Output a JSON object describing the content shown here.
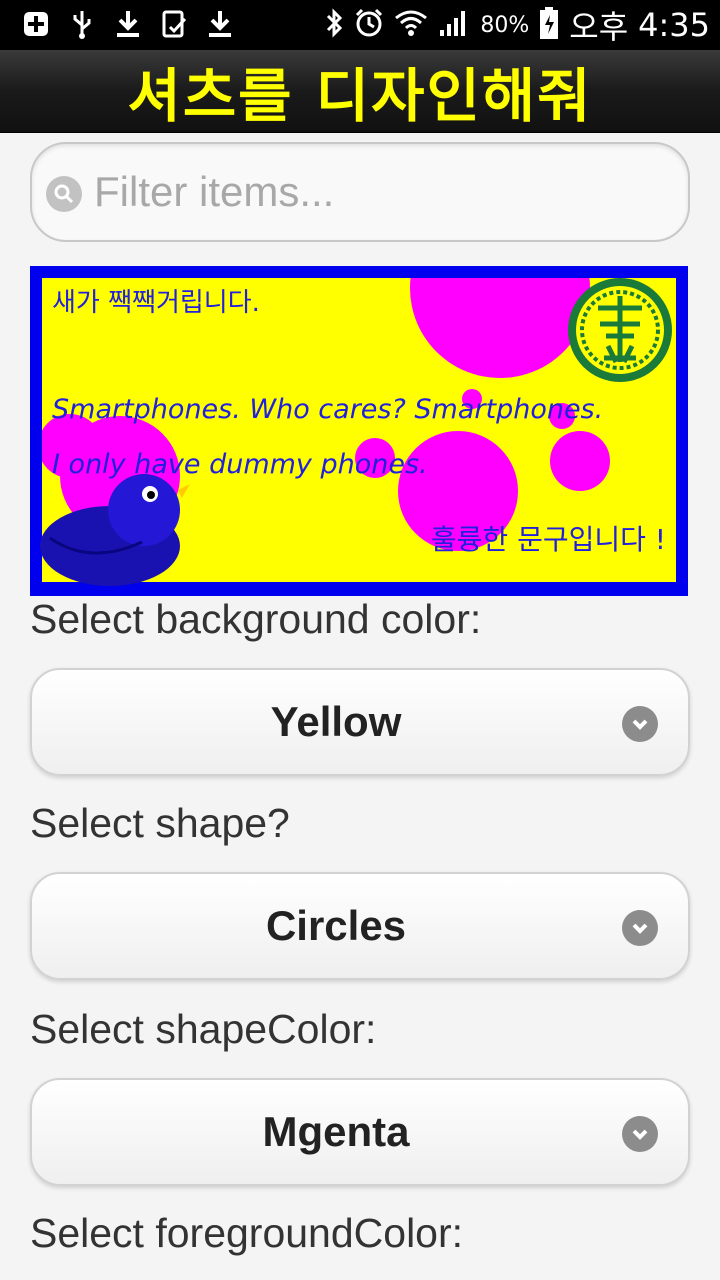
{
  "status_bar": {
    "left_icons": [
      "add-icon",
      "usb-icon",
      "download-icon",
      "screenshot-icon",
      "download-icon"
    ],
    "battery": "80%",
    "carrier_time_prefix": "오후",
    "time": "4:35"
  },
  "header": {
    "title": "셔츠를 디자인해줘"
  },
  "search": {
    "placeholder": "Filter items..."
  },
  "shirt_preview": {
    "korean_line": "새가 짹짹거립니다.",
    "english_line_1": "Smartphones. Who cares? Smartphones.",
    "english_line_2": "I only have dummy phones.",
    "footer_line": "훌륭한 문구입니다 !",
    "colors": {
      "border": "#0000ee",
      "background": "#ffff00",
      "shapes": "#ff00ff",
      "text": "#2020dd",
      "seal": "#1a7a3a"
    }
  },
  "fields": [
    {
      "label": "Select background color:",
      "value": "Yellow"
    },
    {
      "label": "Select shape?",
      "value": "Circles"
    },
    {
      "label": "Select shapeColor:",
      "value": "Mgenta"
    },
    {
      "label": "Select foregroundColor:",
      "value": ""
    }
  ],
  "colors": {
    "header_title": "#ffff00",
    "header_bg": "#1a1a1a"
  }
}
